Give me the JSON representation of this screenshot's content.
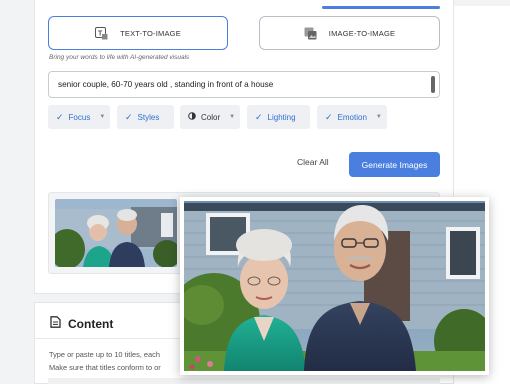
{
  "modes": [
    {
      "label": "TEXT-TO-IMAGE",
      "icon": "text-image-icon",
      "active": true
    },
    {
      "label": "IMAGE-TO-IMAGE",
      "icon": "image-image-icon",
      "active": false
    }
  ],
  "tagline": "Bring your words to life with AI-generated visuals",
  "prompt": {
    "value": "senior couple, 60-70 years old , standing in front of a house"
  },
  "chips": [
    {
      "label": "Focus",
      "icon": "check-icon",
      "dropdown": true
    },
    {
      "label": "Styles",
      "icon": "check-icon",
      "dropdown": false
    },
    {
      "label": "Color",
      "icon": "color-contrast-icon",
      "dropdown": true
    },
    {
      "label": "Lighting",
      "icon": "check-icon",
      "dropdown": false
    },
    {
      "label": "Emotion",
      "icon": "check-icon",
      "dropdown": true
    }
  ],
  "actions": {
    "clear": "Clear All",
    "generate": "Generate Images"
  },
  "content": {
    "title": "Content",
    "icon": "document-icon",
    "line1": "Type or paste up to 10 titles, each",
    "line2": "Make sure that titles conform to or"
  },
  "colors": {
    "accent": "#4a7fe0",
    "chip_text": "#2f6fd1"
  }
}
